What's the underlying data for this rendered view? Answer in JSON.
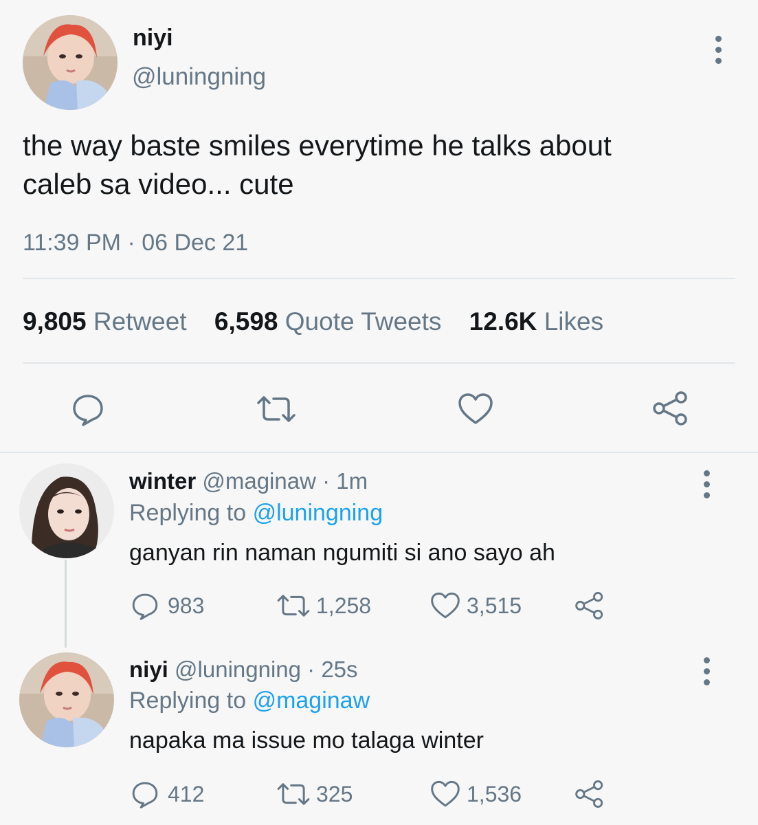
{
  "main_tweet": {
    "name": "niyi",
    "handle": "@luningning",
    "text_line1": "the way baste smiles everytime he talks about",
    "text_line2": "caleb sa video... cute",
    "timestamp": "11:39 PM · 06 Dec 21",
    "stats": {
      "retweet_count": "9,805",
      "retweet_label": "Retweet",
      "quote_count": "6,598",
      "quote_label": "Quote Tweets",
      "like_count": "12.6K",
      "like_label": "Likes"
    }
  },
  "replies": [
    {
      "name": "winter",
      "handle_time": "@maginaw · 1m",
      "replying_prefix": "Replying to",
      "replying_handle": "@luningning",
      "text": "ganyan rin naman ngumiti si ano sayo ah",
      "reply_count": "983",
      "retweet_count": "1,258",
      "like_count": "3,515"
    },
    {
      "name": "niyi",
      "handle_time": "@luningning · 25s",
      "replying_prefix": "Replying to",
      "replying_handle": "@maginaw",
      "text": "napaka ma issue mo talaga winter",
      "reply_count": "412",
      "retweet_count": "325",
      "like_count": "1,536"
    }
  ],
  "icons": {
    "reply": "speech-bubble-icon",
    "retweet": "retweet-icon",
    "like": "heart-icon",
    "share": "share-icon",
    "more": "vertical-dots-icon"
  },
  "colors": {
    "text": "#14171a",
    "muted": "#657786",
    "link": "#1da1f2",
    "divider": "#e1e6ea"
  }
}
